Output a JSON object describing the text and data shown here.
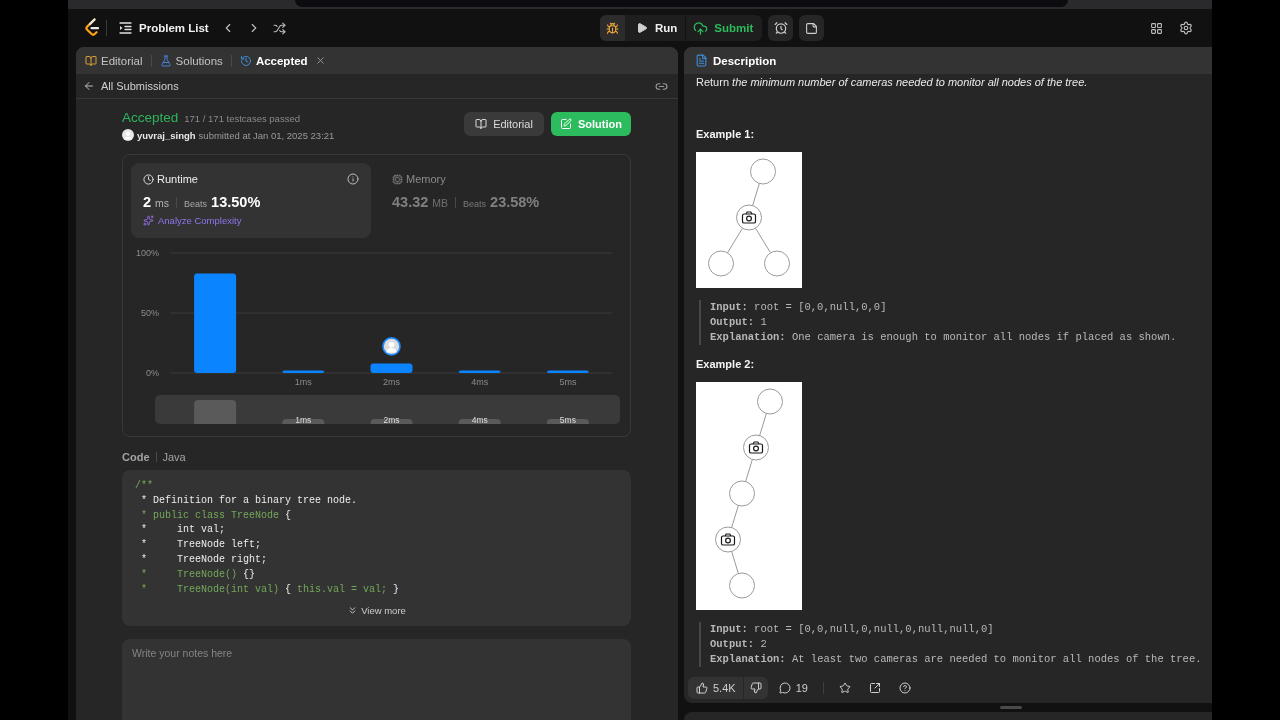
{
  "nav": {
    "problem_list": "Problem List",
    "run": "Run",
    "submit": "Submit"
  },
  "left_panel": {
    "tabs": [
      {
        "kind": "editorial",
        "label": "Editorial",
        "selected": false,
        "closable": false
      },
      {
        "kind": "solutions",
        "label": "Solutions",
        "selected": false,
        "closable": false
      },
      {
        "kind": "submission",
        "label": "Accepted",
        "selected": true,
        "closable": true
      }
    ],
    "back_link": "All Submissions",
    "submission": {
      "status": "Accepted",
      "testcases": "171 / 171 testcases passed",
      "user": "yuvraj_singh",
      "submitted_at": "submitted at Jan 01, 2025 23:21",
      "buttons": [
        {
          "kind": "editorial",
          "label": "Editorial"
        },
        {
          "kind": "solution",
          "label": "Solution"
        }
      ]
    },
    "metrics": [
      {
        "kind": "runtime",
        "label": "Runtime",
        "value": "2",
        "unit": "ms",
        "beats_label": "Beats",
        "beats": "13.50%",
        "selected": true,
        "action": "Analyze Complexity"
      },
      {
        "kind": "memory",
        "label": "Memory",
        "value": "43.32",
        "unit": "MB",
        "beats_label": "Beats",
        "beats": "23.58%",
        "selected": false
      }
    ],
    "chart_data": {
      "type": "bar",
      "categories": [
        null,
        "1ms",
        "2ms",
        "4ms",
        "5ms"
      ],
      "values": [
        83,
        2,
        8,
        2,
        2
      ],
      "ylim": [
        0,
        100
      ],
      "yticks": [
        {
          "value": 0,
          "label": "0%"
        },
        {
          "value": 50,
          "label": "50%"
        },
        {
          "value": 100,
          "label": "100%"
        }
      ],
      "annotations": [
        {
          "x": "2ms"
        }
      ]
    },
    "navigator": {
      "labels": [
        "1ms",
        "2ms",
        "4ms",
        "5ms"
      ]
    },
    "code": {
      "label": "Code",
      "language": "Java",
      "lines": [
        [
          {
            "kind": "comment",
            "text": "/**"
          }
        ],
        [
          {
            "kind": "plain",
            "text": " * Definition for a binary tree node."
          }
        ],
        [
          {
            "kind": "comment",
            "text": " * public class TreeNode"
          },
          {
            "kind": "plain",
            "text": " {"
          }
        ],
        [
          {
            "kind": "plain",
            "text": " *     int val;"
          }
        ],
        [
          {
            "kind": "plain",
            "text": " *     TreeNode left;"
          }
        ],
        [
          {
            "kind": "plain",
            "text": " *     TreeNode right;"
          }
        ],
        [
          {
            "kind": "comment",
            "text": " *     TreeNode()"
          },
          {
            "kind": "plain",
            "text": " {}"
          }
        ],
        [
          {
            "kind": "comment",
            "text": " *     TreeNode(int val)"
          },
          {
            "kind": "plain",
            "text": " { "
          },
          {
            "kind": "comment",
            "text": "this.val = val;"
          },
          {
            "kind": "plain",
            "text": " }"
          }
        ]
      ],
      "view_more": "View more"
    },
    "notes": {
      "placeholder": "Write your notes here"
    }
  },
  "right_panel": {
    "tabs": [
      {
        "label": "Description",
        "selected": true
      }
    ],
    "statement": "Return *the minimum number of cameras needed to monitor all nodes of the tree.*",
    "examples": [
      {
        "title": "Example 1:",
        "tree": {
          "camera": false,
          "children": [
            {
              "camera": true,
              "children": [
                {
                  "camera": false
                },
                {
                  "camera": false
                }
              ]
            }
          ]
        },
        "lines": [
          "**Input:** root = [0,0,null,0,0]",
          "**Output:** 1",
          "**Explanation:** One camera is enough to monitor all nodes if placed as shown."
        ]
      },
      {
        "title": "Example 2:",
        "tree": {
          "camera": false,
          "children": [
            {
              "camera": true,
              "children": [
                {
                  "camera": false,
                  "children": [
                    {
                      "camera": true,
                      "children": [
                        {
                          "camera": false
                        }
                      ]
                    }
                  ]
                }
              ]
            }
          ]
        },
        "lines": [
          "**Input:** root = [0,0,null,0,null,0,null,null,0]",
          "**Output:** 2",
          "**Explanation:** At least two cameras are needed to monitor all nodes of the tree."
        ]
      }
    ],
    "footer": {
      "likes": "5.4K",
      "comments": "19"
    }
  }
}
